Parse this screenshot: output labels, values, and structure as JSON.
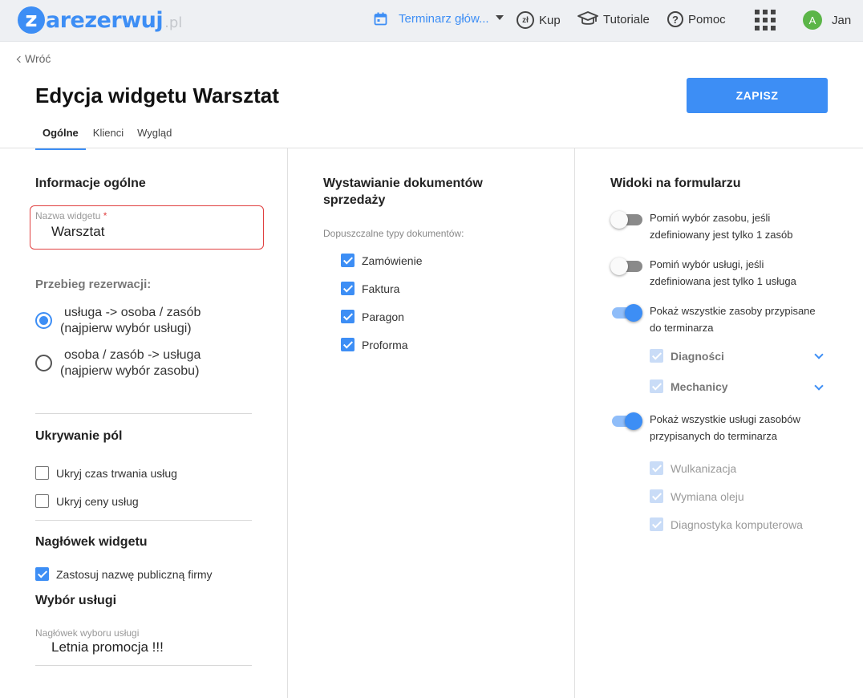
{
  "topbar": {
    "logo_letter": "z",
    "logo_text": "arezerwuj",
    "logo_tld": ".pl",
    "calendar_label": "Terminarz głów...",
    "buy_label": "Kup",
    "buy_icon_text": "zł",
    "tutorials_label": "Tutoriale",
    "help_label": "Pomoc",
    "user_initial": "A",
    "user_name": "Jan"
  },
  "header": {
    "back_label": "Wróć",
    "title": "Edycja widgetu Warsztat",
    "save_label": "ZAPISZ",
    "tabs": [
      {
        "label": "Ogólne",
        "active": true
      },
      {
        "label": "Klienci",
        "active": false
      },
      {
        "label": "Wygląd",
        "active": false
      }
    ]
  },
  "general": {
    "title": "Informacje ogólne",
    "name_label": "Nazwa widgetu",
    "required_mark": "*",
    "name_value": "Warsztat",
    "flow_label": "Przebieg rezerwacji:",
    "flow_options": [
      {
        "line1": "usługa -> osoba / zasób",
        "line2": "(najpierw wybór usługi)",
        "selected": true
      },
      {
        "line1": "osoba / zasób -> usługa",
        "line2": "(najpierw wybór zasobu)",
        "selected": false
      }
    ],
    "hide_title": "Ukrywanie pól",
    "hide_options": [
      {
        "label": "Ukryj czas trwania usług",
        "checked": false
      },
      {
        "label": "Ukryj ceny usług",
        "checked": false
      }
    ],
    "widget_header_title": "Nagłówek widgetu",
    "widget_header_option": {
      "label": "Zastosuj nazwę publiczną firmy",
      "checked": true
    },
    "service_title": "Wybór usługi",
    "service_header_label": "Nagłówek wyboru usługi",
    "service_header_value": "Letnia promocja !!!"
  },
  "documents": {
    "title_line1": "Wystawianie dokumentów",
    "title_line2": "sprzedaży",
    "types_label": "Dopuszczalne typy dokumentów:",
    "types": [
      {
        "label": "Zamówienie",
        "checked": true
      },
      {
        "label": "Faktura",
        "checked": true
      },
      {
        "label": "Paragon",
        "checked": true
      },
      {
        "label": "Proforma",
        "checked": true
      }
    ]
  },
  "views": {
    "title": "Widoki na formularzu",
    "toggles": [
      {
        "line1": "Pomiń wybór zasobu, jeśli",
        "line2": "zdefiniowany jest tylko 1 zasób",
        "on": false
      },
      {
        "line1": "Pomiń wybór usługi, jeśli",
        "line2": "zdefiniowana jest tylko 1 usługa",
        "on": false
      },
      {
        "line1": "Pokaż wszystkie zasoby przypisane",
        "line2": "do terminarza",
        "on": true
      },
      {
        "line1": "Pokaż wszystkie usługi zasobów",
        "line2": "przypisanych do terminarza",
        "on": true
      }
    ],
    "resource_groups": [
      {
        "label": "Diagności",
        "checked": true
      },
      {
        "label": "Mechanicy",
        "checked": true
      }
    ],
    "services": [
      {
        "label": "Wulkanizacja",
        "checked": true
      },
      {
        "label": "Wymiana oleju",
        "checked": true
      },
      {
        "label": "Diagnostyka komputerowa",
        "checked": true
      }
    ]
  },
  "colors": {
    "accent": "#3d8ef5",
    "error": "#e04040",
    "avatar": "#5bb548"
  }
}
